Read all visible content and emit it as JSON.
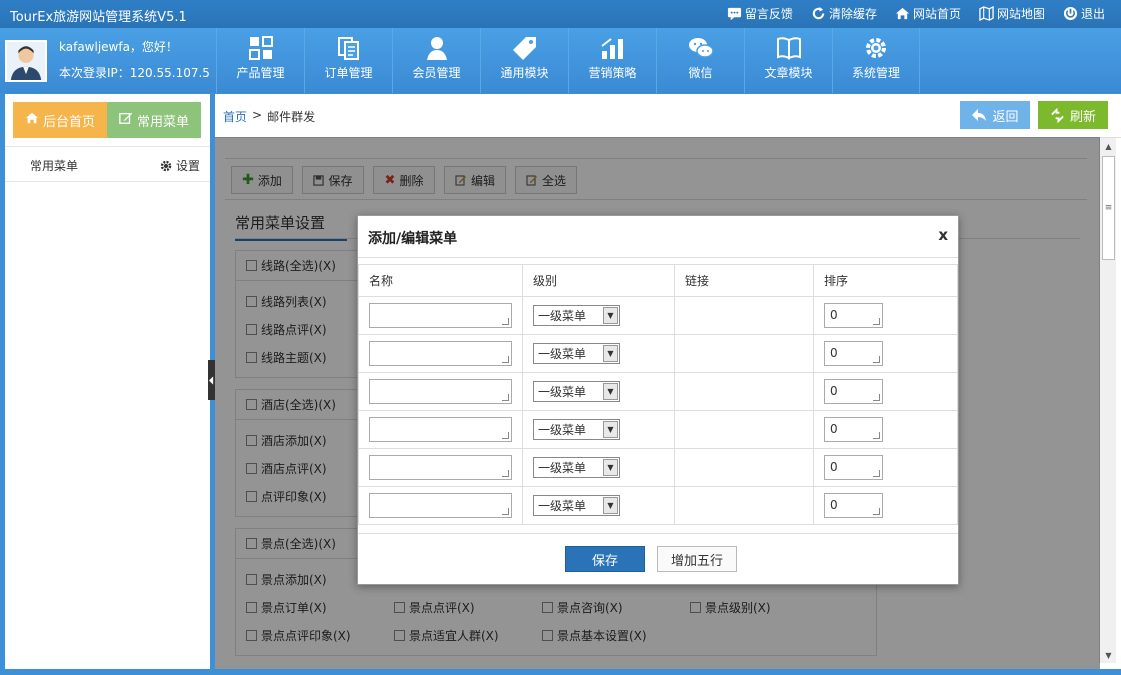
{
  "topbar": {
    "title": "TourEx旅游网站管理系统V5.1",
    "links": [
      {
        "label": "留言反馈",
        "icon": "message-icon"
      },
      {
        "label": "清除缓存",
        "icon": "refresh-icon"
      },
      {
        "label": "网站首页",
        "icon": "home-icon"
      },
      {
        "label": "网站地图",
        "icon": "map-icon"
      },
      {
        "label": "退出",
        "icon": "power-icon"
      }
    ]
  },
  "user": {
    "greeting": "kafawljewfa，您好！",
    "last_login": "本次登录IP：120.55.107.5"
  },
  "nav": [
    {
      "label": "产品管理",
      "icon": "grid-icon"
    },
    {
      "label": "订单管理",
      "icon": "document-icon"
    },
    {
      "label": "会员管理",
      "icon": "user-icon"
    },
    {
      "label": "通用模块",
      "icon": "tag-icon"
    },
    {
      "label": "营销策略",
      "icon": "chart-icon"
    },
    {
      "label": "微信",
      "icon": "wechat-icon"
    },
    {
      "label": "文章模块",
      "icon": "book-icon"
    },
    {
      "label": "系统管理",
      "icon": "gear-icon"
    }
  ],
  "sidebar": {
    "tab_home": "后台首页",
    "tab_menu": "常用菜单",
    "row_label": "常用菜单",
    "row_settings": "设置"
  },
  "breadcrumb": {
    "home": "首页",
    "separator": ">",
    "current": "邮件群发"
  },
  "actions": {
    "back": "返回",
    "refresh": "刷新"
  },
  "toolbar": {
    "add": "添加",
    "save": "保存",
    "delete": "删除",
    "edit": "编辑",
    "select_all": "全选"
  },
  "section_title": "常用菜单设置",
  "groups": [
    {
      "head": "线路(全选)(X)",
      "items": [
        "线路列表(X)",
        "线路点评(X)",
        "线路主题(X)"
      ]
    },
    {
      "head": "酒店(全选)(X)",
      "items": [
        "酒店添加(X)",
        "酒店点评(X)",
        "点评印象(X)"
      ]
    },
    {
      "head": "景点(全选)(X)",
      "items": [
        "景点添加(X)",
        "景点订单(X)",
        "景点点评(X)",
        "景点咨询(X)",
        "景点级别(X)",
        "景点点评印象(X)",
        "景点适宜人群(X)",
        "景点基本设置(X)"
      ]
    }
  ],
  "dialog": {
    "title": "添加/编辑菜单",
    "close": "x",
    "columns": [
      "名称",
      "级别",
      "链接",
      "排序"
    ],
    "rows": [
      {
        "name": "",
        "level": "一级菜单",
        "link": "",
        "sort": "0"
      },
      {
        "name": "",
        "level": "一级菜单",
        "link": "",
        "sort": "0"
      },
      {
        "name": "",
        "level": "一级菜单",
        "link": "",
        "sort": "0"
      },
      {
        "name": "",
        "level": "一级菜单",
        "link": "",
        "sort": "0"
      },
      {
        "name": "",
        "level": "一级菜单",
        "link": "",
        "sort": "0"
      },
      {
        "name": "",
        "level": "一级菜单",
        "link": "",
        "sort": "0"
      }
    ],
    "save": "保存",
    "add_five": "增加五行"
  }
}
